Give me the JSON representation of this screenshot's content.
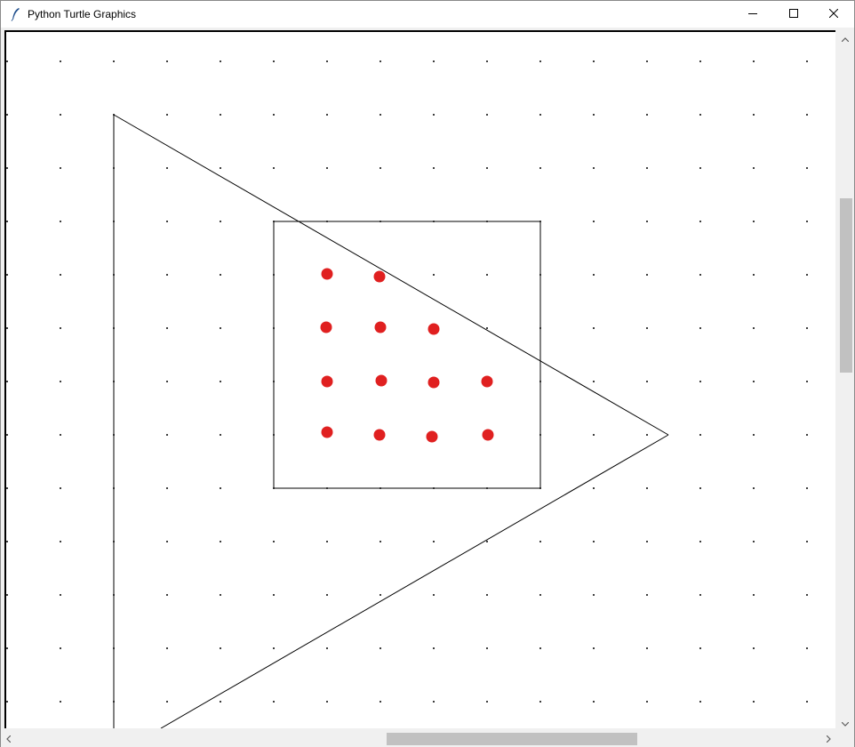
{
  "window": {
    "title": "Python Turtle Graphics",
    "icons": {
      "app": "feather-icon",
      "minimize": "minimize-icon",
      "maximize": "maximize-icon",
      "close": "close-icon"
    }
  },
  "canvas": {
    "background": "#ffffff",
    "grid_dot_color": "#000000",
    "outline_color": "#000000",
    "dot_color": "#e02020",
    "dots_per_row": [
      2,
      3,
      4,
      4
    ]
  },
  "scrollbars": {
    "vertical_thumb_fraction": 0.25,
    "horizontal_thumb_fraction": 0.3,
    "icons": {
      "up": "chevron-up-icon",
      "down": "chevron-down-icon",
      "left": "chevron-left-icon",
      "right": "chevron-right-icon"
    }
  }
}
